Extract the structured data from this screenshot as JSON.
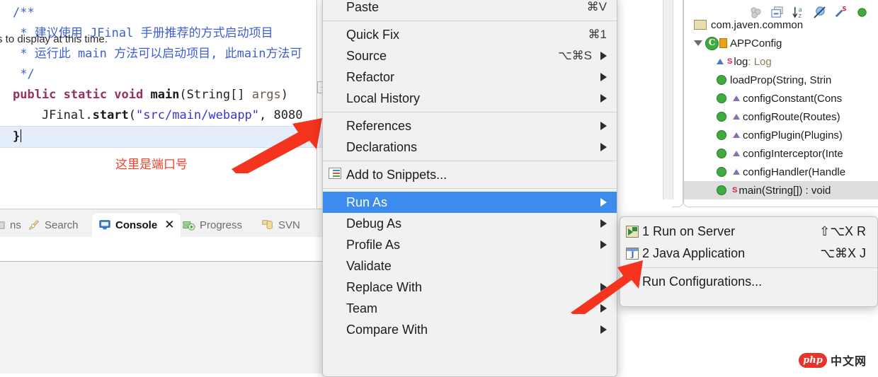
{
  "editor": {
    "code_lines": [
      {
        "id": "l1",
        "segments": [
          {
            "text": "/**",
            "cls": "cmt"
          }
        ]
      },
      {
        "id": "l2",
        "segments": [
          {
            "text": " * 建议使用 JFinal 手册推荐的方式启动项目",
            "cls": "cmt"
          }
        ]
      },
      {
        "id": "l3",
        "segments": [
          {
            "text": " * 运行此 main 方法可以启动项目, 此main方法可",
            "cls": "cmt"
          }
        ]
      },
      {
        "id": "l4",
        "segments": [
          {
            "text": " */",
            "cls": "cmt"
          }
        ]
      },
      {
        "id": "l5",
        "segments": [
          {
            "text": "public static void ",
            "cls": "kw"
          },
          {
            "text": "main",
            "cls": "mth"
          },
          {
            "text": "(String[] ",
            "cls": "plain"
          },
          {
            "text": "args",
            "cls": "param"
          },
          {
            "text": ") ",
            "cls": "plain"
          }
        ]
      },
      {
        "id": "l6",
        "segments": [
          {
            "text": "    JFinal.",
            "cls": "plain"
          },
          {
            "text": "start",
            "cls": "mth"
          },
          {
            "text": "(",
            "cls": "plain"
          },
          {
            "text": "\"src/main/webapp\"",
            "cls": "str"
          },
          {
            "text": ", 8080",
            "cls": "plain"
          }
        ]
      }
    ],
    "current_line_text": "}",
    "fold_marker": "{",
    "annotation": "这里是端口号"
  },
  "bottom_panel": {
    "tabs": [
      {
        "label": "ns",
        "icon": "cut-off-tab-icon",
        "selected": false
      },
      {
        "label": "Search",
        "icon": "search-pencil-icon",
        "selected": false
      },
      {
        "label": "Console",
        "icon": "console-monitor-icon",
        "selected": true,
        "close": "✕"
      },
      {
        "label": "Progress",
        "icon": "progress-icon",
        "selected": false
      },
      {
        "label": "SVN",
        "icon": "svn-repo-icon",
        "selected": false
      }
    ],
    "console_message": "s to display at this time."
  },
  "outline": {
    "toolbar_icons": [
      "hide-fields-icon",
      "collapse-all-icon",
      "sort-alphabetical-icon",
      "hide-non-public-icon",
      "hide-static-icon",
      "show-members-icon"
    ],
    "tree": [
      {
        "label": "com.javen.common",
        "icon": "package-icon",
        "indent": 0,
        "selected": false
      },
      {
        "label": "APPConfig",
        "icon": "class-icon",
        "indent": 0,
        "selected": false,
        "expanded": true,
        "lock": true
      },
      {
        "label": "log",
        "type": ": Log",
        "icon": "field-icon",
        "indent": 1,
        "selected": false,
        "static": true
      },
      {
        "label": "loadProp(String, Strin",
        "icon": "method-icon",
        "indent": 1,
        "selected": false
      },
      {
        "label": "configConstant(Cons",
        "icon": "method-icon",
        "indent": 1,
        "selected": false,
        "override": true
      },
      {
        "label": "configRoute(Routes)",
        "icon": "method-icon",
        "indent": 1,
        "selected": false,
        "override": true
      },
      {
        "label": "configPlugin(Plugins)",
        "icon": "method-icon",
        "indent": 1,
        "selected": false,
        "override": true
      },
      {
        "label": "configInterceptor(Inte",
        "icon": "method-icon",
        "indent": 1,
        "selected": false,
        "override": true
      },
      {
        "label": "configHandler(Handle",
        "icon": "method-icon",
        "indent": 1,
        "selected": false,
        "override": true
      },
      {
        "label": "main(String[]) : void",
        "icon": "method-icon",
        "indent": 1,
        "selected": true,
        "static": true
      }
    ]
  },
  "context_menu": {
    "items": [
      {
        "label": "Paste",
        "shortcut": "⌘V",
        "submenu": false,
        "highlighted": false
      },
      {
        "separator": true
      },
      {
        "label": "Quick Fix",
        "shortcut": "⌘1",
        "submenu": false,
        "highlighted": false
      },
      {
        "label": "Source",
        "shortcut": "⌥⌘S",
        "submenu": true,
        "highlighted": false
      },
      {
        "label": "Refactor",
        "shortcut": "",
        "submenu": true,
        "highlighted": false
      },
      {
        "label": "Local History",
        "shortcut": "",
        "submenu": true,
        "highlighted": false
      },
      {
        "separator": true
      },
      {
        "label": "References",
        "shortcut": "",
        "submenu": true,
        "highlighted": false
      },
      {
        "label": "Declarations",
        "shortcut": "",
        "submenu": true,
        "highlighted": false
      },
      {
        "separator": true
      },
      {
        "label": "Add to Snippets...",
        "shortcut": "",
        "submenu": false,
        "highlighted": false,
        "icon": "snippets-icon"
      },
      {
        "separator": true
      },
      {
        "label": "Run As",
        "shortcut": "",
        "submenu": true,
        "highlighted": true
      },
      {
        "label": "Debug As",
        "shortcut": "",
        "submenu": true,
        "highlighted": false
      },
      {
        "label": "Profile As",
        "shortcut": "",
        "submenu": true,
        "highlighted": false
      },
      {
        "label": "Validate",
        "shortcut": "",
        "submenu": false,
        "highlighted": false
      },
      {
        "label": "Replace With",
        "shortcut": "",
        "submenu": true,
        "highlighted": false
      },
      {
        "label": "Team",
        "shortcut": "",
        "submenu": true,
        "highlighted": false
      },
      {
        "label": "Compare With",
        "shortcut": "",
        "submenu": true,
        "highlighted": false
      }
    ]
  },
  "submenu": {
    "items": [
      {
        "label": "1 Run on Server",
        "shortcut": "⇧⌥X R",
        "icon": "run-on-server-icon"
      },
      {
        "label": "2 Java Application",
        "shortcut": "⌥⌘X J",
        "icon": "java-application-icon"
      },
      {
        "separator": true
      },
      {
        "label": "Run Configurations...",
        "shortcut": "",
        "icon": ""
      }
    ]
  },
  "watermark": {
    "badge": "php",
    "text": "中文网"
  },
  "colors": {
    "menu_highlight": "#3b8ced",
    "annotation_red": "#f4412a",
    "comment_blue": "#3f5fd0",
    "string_blue": "#3a34d4",
    "keyword_magenta": "#9b2f63",
    "current_line": "#e4eefb",
    "menu_bg": "#f1f1f1"
  }
}
